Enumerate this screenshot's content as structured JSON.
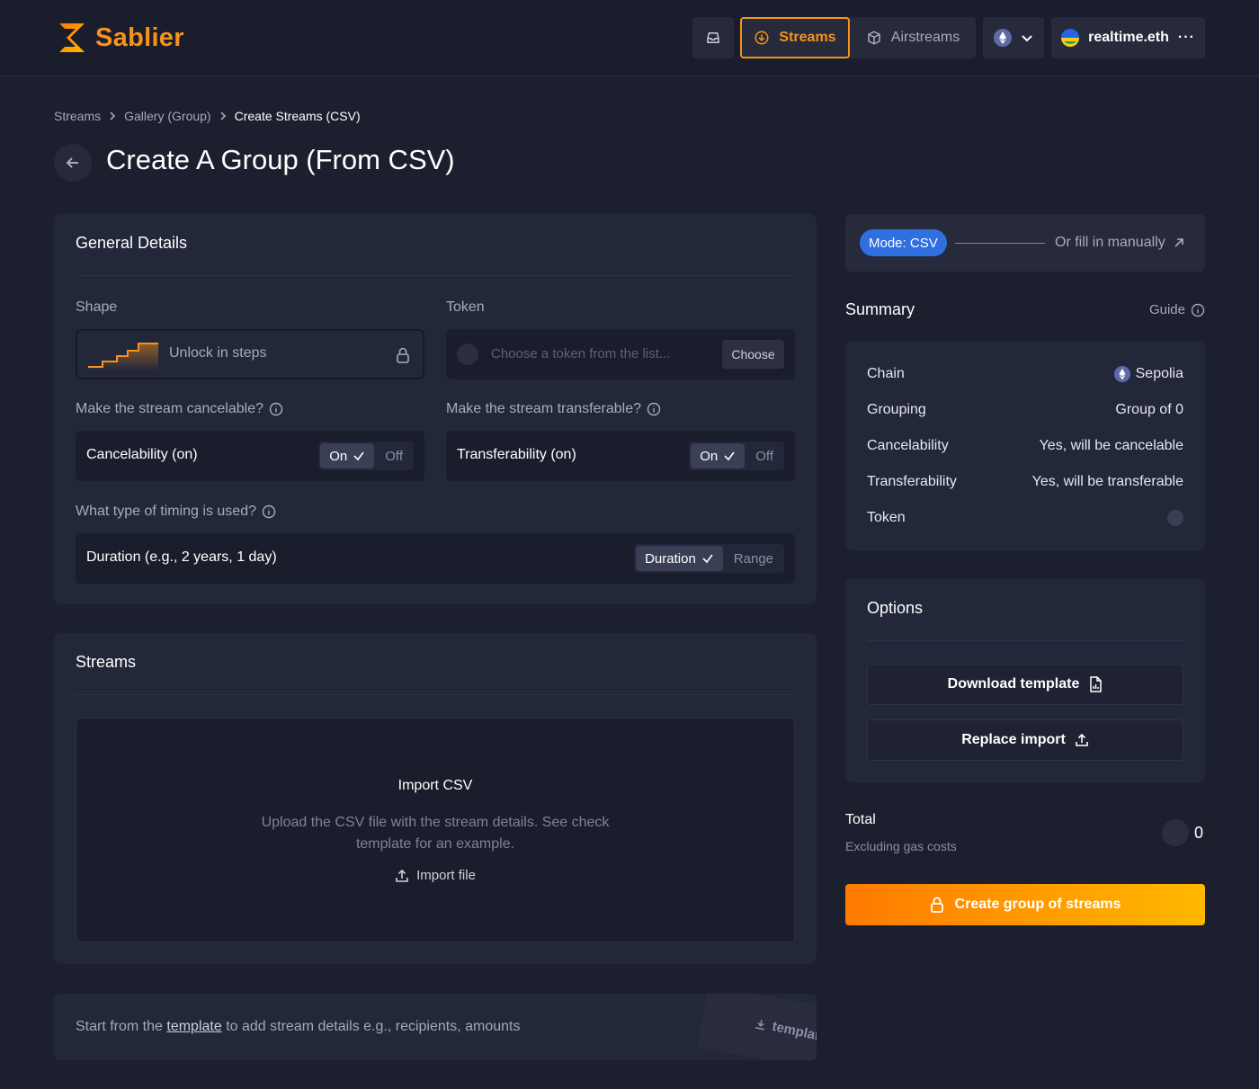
{
  "brand": {
    "name": "Sablier",
    "accent": "#f7931a"
  },
  "nav": {
    "streams_label": "Streams",
    "airstreams_label": "Airstreams",
    "account_label": "realtime.eth"
  },
  "breadcrumb": [
    "Streams",
    "Gallery (Group)",
    "Create Streams (CSV)"
  ],
  "page_title": "Create A Group (From CSV)",
  "general": {
    "title": "General Details",
    "shape_label": "Shape",
    "shape_value": "Unlock in steps",
    "token_label": "Token",
    "token_placeholder": "Choose a token from the list...",
    "token_choose": "Choose",
    "cancel_question": "Make the stream cancelable?",
    "cancel_text": "Cancelability (on)",
    "transfer_question": "Make the stream transferable?",
    "transfer_text": "Transferability (on)",
    "on_label": "On",
    "off_label": "Off",
    "timing_question": "What type of timing is used?",
    "timing_text": "Duration (e.g., 2 years, 1 day)",
    "timing_selected": "Duration",
    "timing_other": "Range"
  },
  "streams": {
    "title": "Streams",
    "import_title": "Import CSV",
    "import_desc": "Upload the CSV file with the stream details. See check template for an example.",
    "import_button": "Import file"
  },
  "hint": {
    "prefix": "Start from the ",
    "link": "template",
    "suffix": " to add stream details e.g., recipients, amounts",
    "file_label": "template.csv"
  },
  "mode": {
    "pill": "Mode: CSV",
    "alt": "Or fill in manually"
  },
  "summary": {
    "title": "Summary",
    "guide": "Guide",
    "rows": [
      {
        "key": "Chain",
        "value": "Sepolia"
      },
      {
        "key": "Grouping",
        "value": "Group of 0"
      },
      {
        "key": "Cancelability",
        "value": "Yes, will be cancelable"
      },
      {
        "key": "Transferability",
        "value": "Yes, will be transferable"
      },
      {
        "key": "Token",
        "value": ""
      }
    ]
  },
  "options": {
    "title": "Options",
    "download": "Download template",
    "replace": "Replace import"
  },
  "total": {
    "label": "Total",
    "sub": "Excluding gas costs",
    "value": "0"
  },
  "cta": {
    "label": "Create group of streams"
  }
}
